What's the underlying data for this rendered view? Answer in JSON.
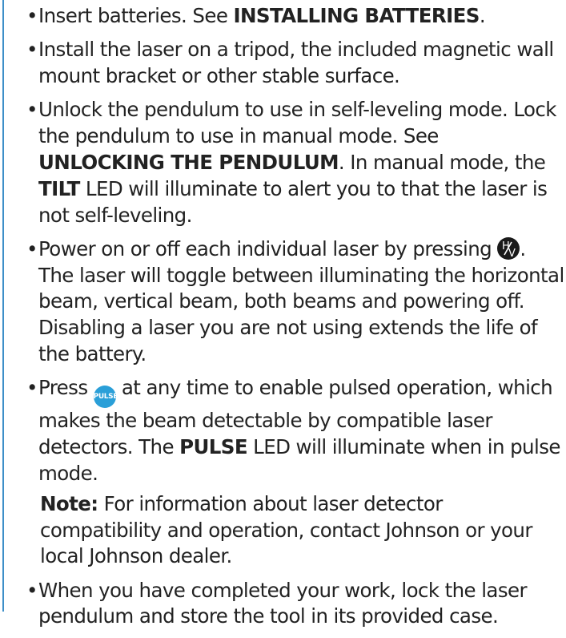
{
  "items": [
    {
      "t1": "Insert batteries. See ",
      "b1": "INSTALLING BATTERIES",
      "t2": "."
    },
    {
      "t1": "Install the laser on a tripod, the included magnetic wall mount bracket or other stable surface."
    },
    {
      "t1": "Unlock the pendulum to use in self-leveling mode. Lock the pendulum to use in manual mode. See ",
      "b1": "UNLOCKING THE PENDULUM",
      "t2": ". In manual mode, the ",
      "b2": "TILT",
      "t3": " LED will illuminate to alert you to that the laser is not self-leveling."
    },
    {
      "t1": "Power on or off each individual laser by pressing ",
      "t2": ". The laser will toggle between illuminating the horizontal beam, vertical beam, both beams and powering off. Disabling a laser you are not using extends the life of the battery."
    },
    {
      "t1": "Press ",
      "t2": " at any time to enable pulsed operation, which makes the beam detectable by compatible laser detectors. The ",
      "b1": "PULSE",
      "t3": " LED will illuminate when in pulse mode.",
      "note_label": "Note:",
      "note_text": " For information about laser detector compatibility and operation, contact Johnson or your local Johnson dealer."
    },
    {
      "t1": "When you have completed your work, lock the laser pendulum and store the tool in its provided case."
    }
  ],
  "buttons": {
    "hv_icon": "hv-button-icon",
    "hv_h": "H",
    "hv_v": "V",
    "pulse_icon": "pulse-button-icon",
    "pulse_label": "PULSE"
  },
  "colors": {
    "rule": "#3d8fc8",
    "pulse_button": "#2a9fd8",
    "hv_button": "#1a1a1a"
  }
}
